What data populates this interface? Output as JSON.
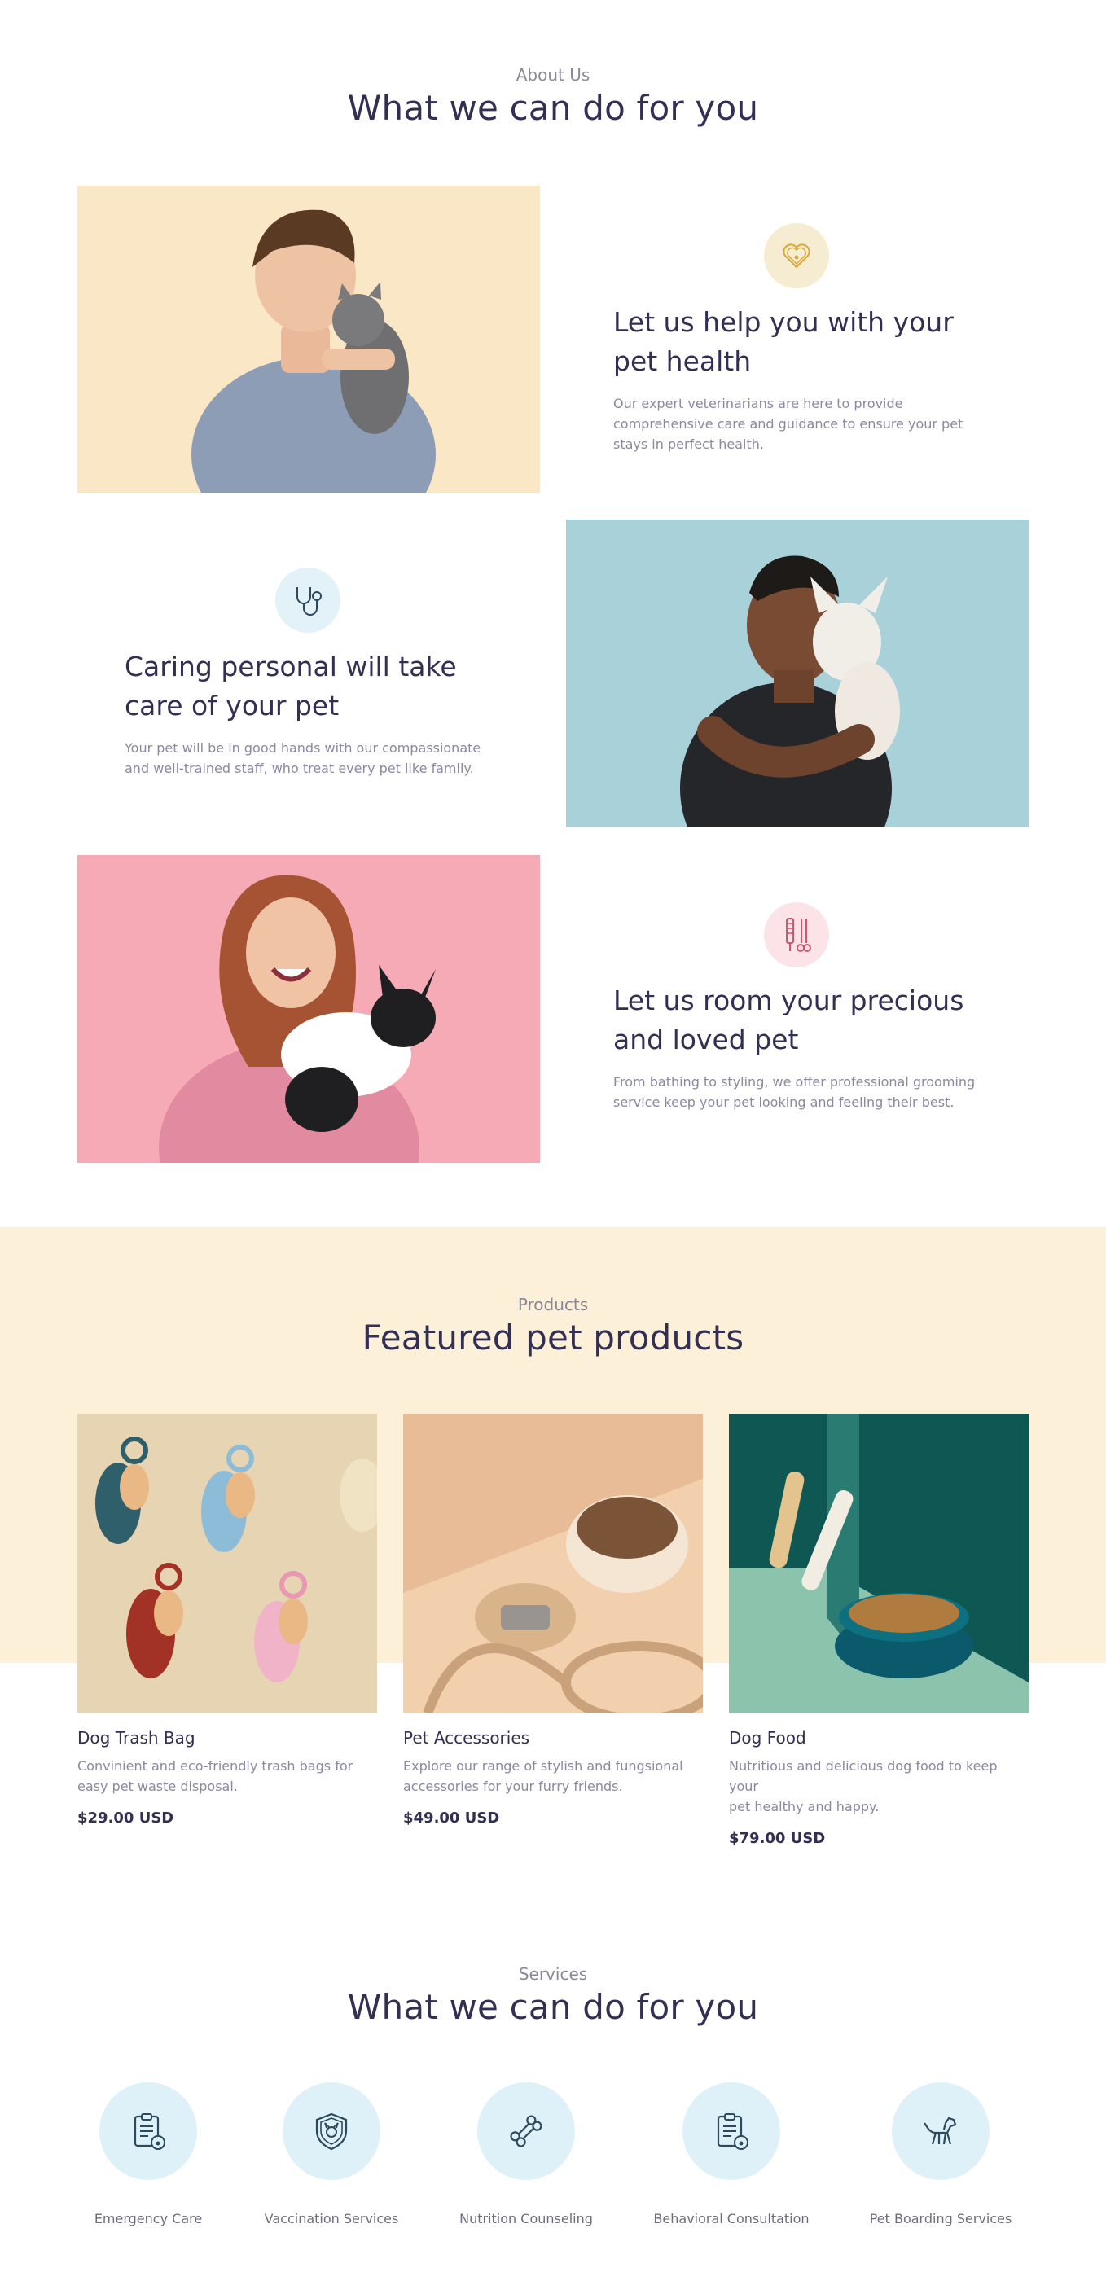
{
  "about": {
    "eyebrow": "About Us",
    "title": "What we can do for you"
  },
  "features": [
    {
      "icon": "heart-paw-icon",
      "icon_color": "#f6ecd1",
      "title_line1": "Let us help you with your",
      "title_line2": "pet health",
      "desc_line1": "Our expert veterinarians are here to provide",
      "desc_line2": "comprehensive care and guidance to ensure your pet",
      "desc_line3": "stays in perfect health."
    },
    {
      "icon": "stethoscope-icon",
      "icon_color": "#e3f2f8",
      "title_line1": "Caring personal will take",
      "title_line2": "care of your pet",
      "desc_line1": "Your pet will be in good hands with our compassionate",
      "desc_line2": "and well-trained staff, who treat every pet like family."
    },
    {
      "icon": "grooming-tools-icon",
      "icon_color": "#fbe3e8",
      "title_line1": "Let us room your precious",
      "title_line2": "and loved pet",
      "desc_line1": "From bathing to styling, we offer professional grooming",
      "desc_line2": "service keep your pet looking and feeling their best."
    }
  ],
  "products": {
    "eyebrow": "Products",
    "title": "Featured pet products",
    "items": [
      {
        "name": "Dog Trash Bag",
        "desc_line1": "Convinient and eco-friendly trash bags for",
        "desc_line2": "easy pet waste disposal.",
        "price": "$29.00 USD"
      },
      {
        "name": "Pet Accessories",
        "desc_line1": "Explore our range of stylish and fungsional",
        "desc_line2": "accessories for your furry friends.",
        "price": "$49.00 USD"
      },
      {
        "name": "Dog Food",
        "desc_line1": "Nutritious and delicious dog food to keep your",
        "desc_line2": "pet healthy and happy.",
        "price": "$79.00 USD"
      }
    ]
  },
  "services": {
    "eyebrow": "Services",
    "title": "What we can do for you",
    "items": [
      {
        "label": "Emergency Care",
        "icon": "clipboard-paw-icon"
      },
      {
        "label": "Vaccination Services",
        "icon": "shield-dog-icon"
      },
      {
        "label": "Nutrition Counseling",
        "icon": "bone-icon"
      },
      {
        "label": "Behavioral Consultation",
        "icon": "clipboard-paw-icon"
      },
      {
        "label": "Pet Boarding Services",
        "icon": "dog-icon"
      }
    ]
  },
  "colors": {
    "heading": "#332f52",
    "body_text": "#8b88a0",
    "band": "#fcf0d9",
    "icon_circle": "#dff1f8",
    "icon_stroke": "#2c4a5e"
  }
}
